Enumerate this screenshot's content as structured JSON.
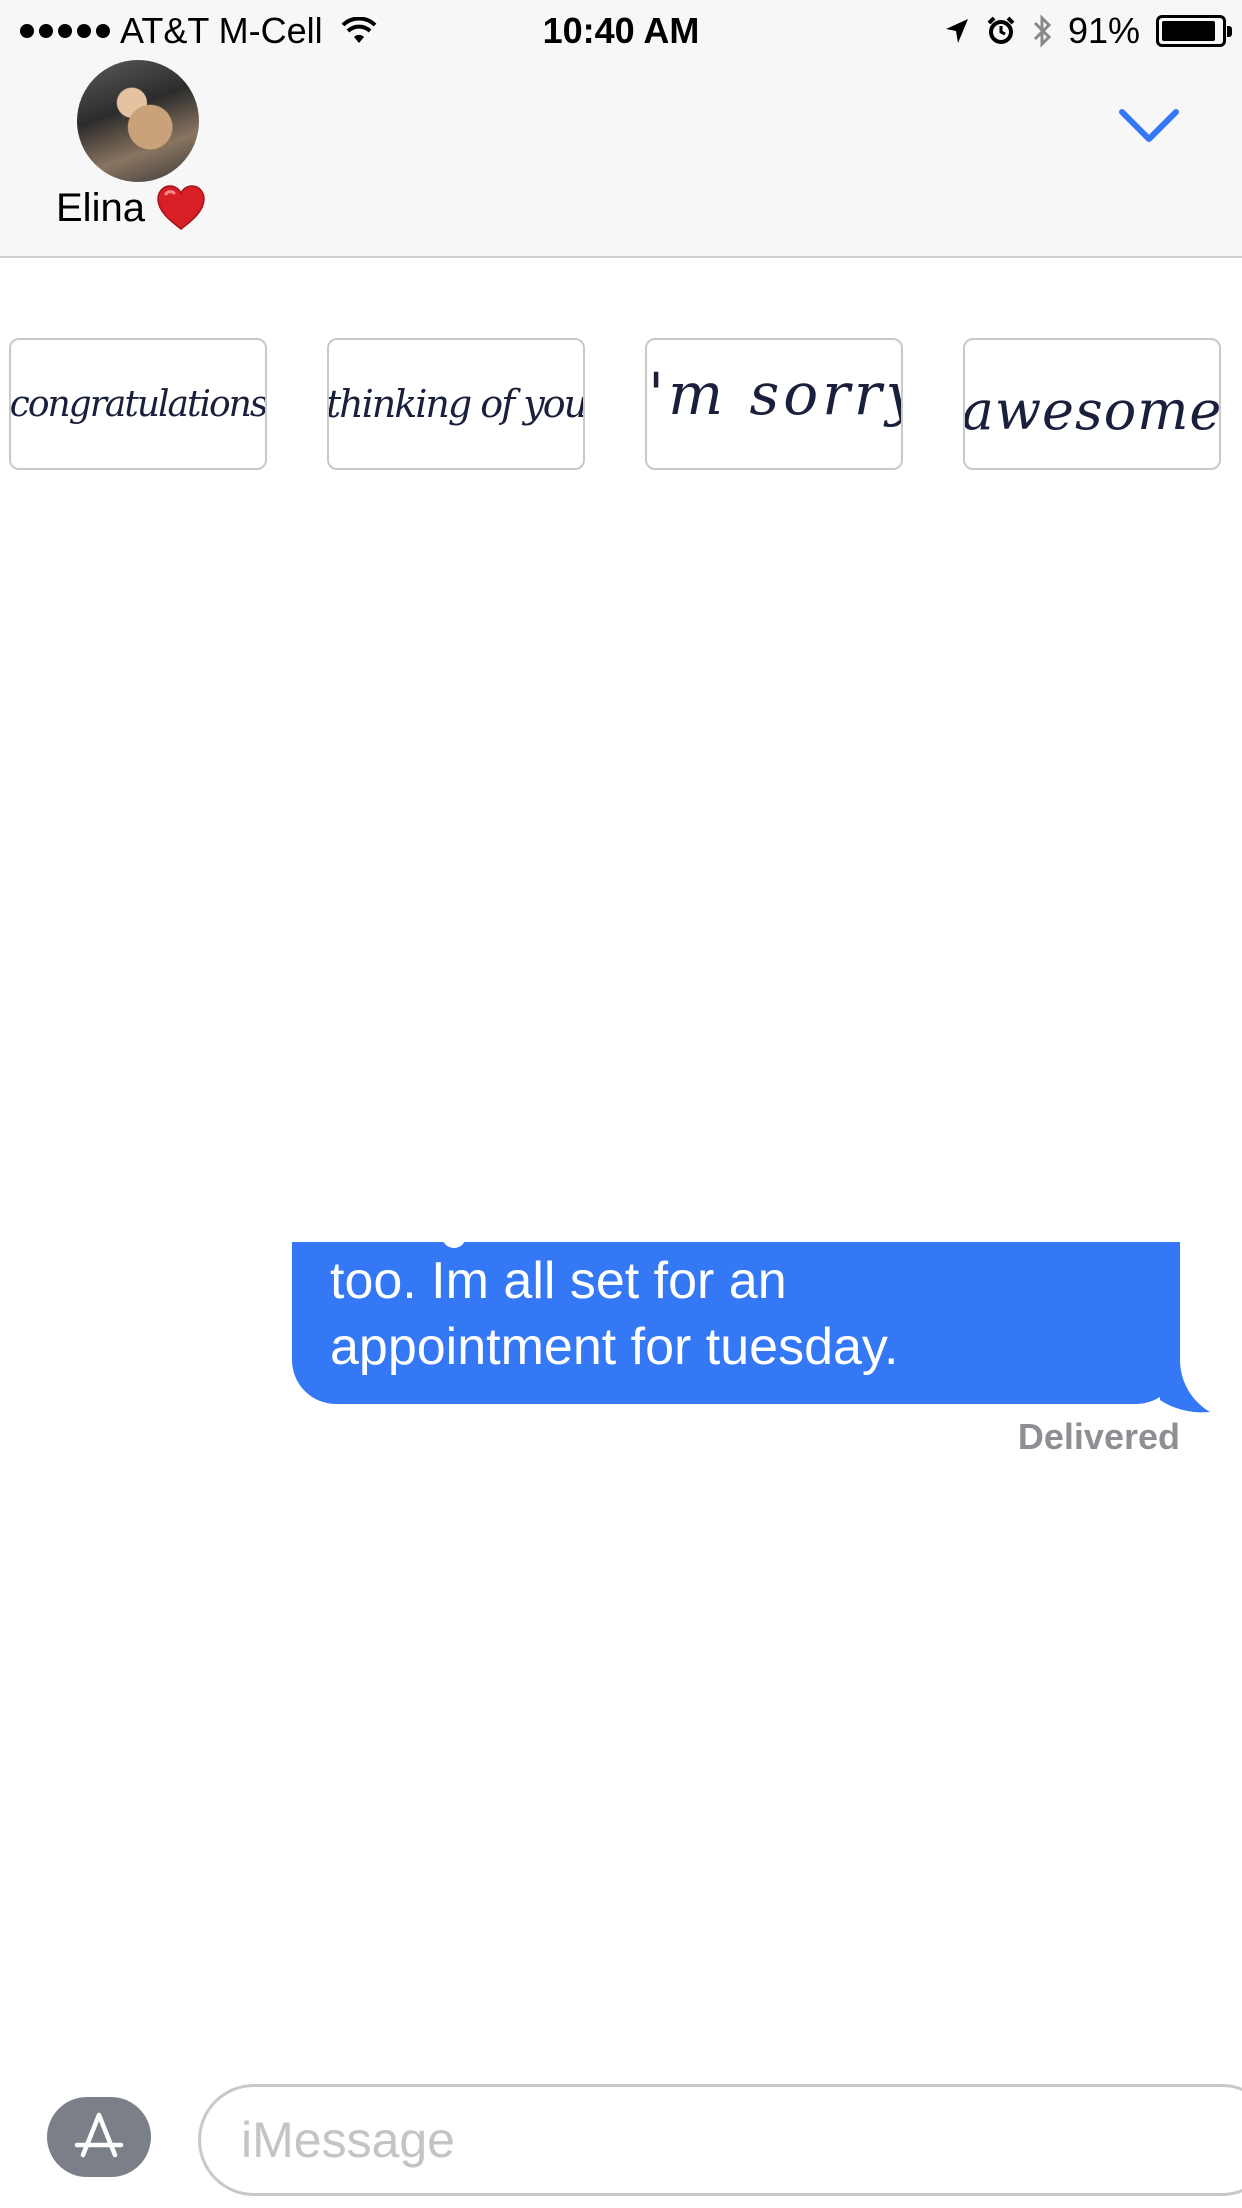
{
  "status_bar": {
    "carrier": "AT&T M-Cell",
    "time": "10:40 AM",
    "battery_percent": "91%",
    "battery_level": 0.91,
    "icons": [
      "signal-dots-icon",
      "wifi-icon",
      "location-arrow-icon",
      "alarm-icon",
      "bluetooth-icon",
      "battery-icon"
    ]
  },
  "header": {
    "contact_name": "Elina",
    "contact_emoji_icon": "red-heart-icon",
    "collapse_icon": "chevron-down-icon",
    "accent_color": "#3478f6"
  },
  "stickers": [
    {
      "label": "congratulations"
    },
    {
      "label": "thinking of you"
    },
    {
      "label": "i'm sorry"
    },
    {
      "label": "awesome"
    }
  ],
  "messages": [
    {
      "direction": "outgoing",
      "lines": [
        "too. Im all set for an",
        "appointment for tuesday."
      ],
      "bubble_color": "#3478f6"
    }
  ],
  "delivery_status": "Delivered",
  "input": {
    "placeholder": "iMessage",
    "apps_icon": "app-store-icon"
  }
}
